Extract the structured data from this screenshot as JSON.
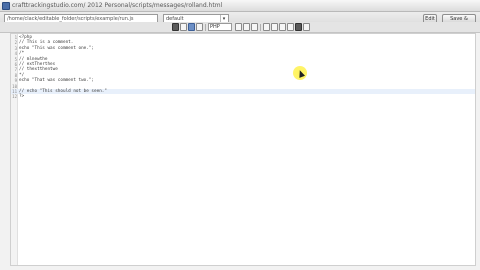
{
  "window": {
    "title": "crafttrackingstudio.com/ 2012 Personal/scripts/messages/rolland.html"
  },
  "toolbar": {
    "path_value": "/home/clack/editable_folder/scripts/example/run.js",
    "select_value": "default",
    "button_1": "Edit",
    "button_2": "Save & Close"
  },
  "iconbar": {
    "syntax_select": "PHP"
  },
  "editor": {
    "lines": [
      {
        "num": "1",
        "code": "<?php"
      },
      {
        "num": "2",
        "code": "// This is a comment."
      },
      {
        "num": "3",
        "code": "echo \"This was comment one.\";"
      },
      {
        "num": "4",
        "code": "/*"
      },
      {
        "num": "5",
        "code": "// mlnewthe"
      },
      {
        "num": "6",
        "code": "// extTherthes"
      },
      {
        "num": "7",
        "code": "// thextthentwe"
      },
      {
        "num": "8",
        "code": "*/"
      },
      {
        "num": "9",
        "code": "echo \"That was comment two.\";"
      },
      {
        "num": "10",
        "code": ""
      },
      {
        "num": "11",
        "code": "// echo \"This should not be seen.\""
      },
      {
        "num": "12",
        "code": "?>"
      }
    ],
    "active_line": 11
  }
}
